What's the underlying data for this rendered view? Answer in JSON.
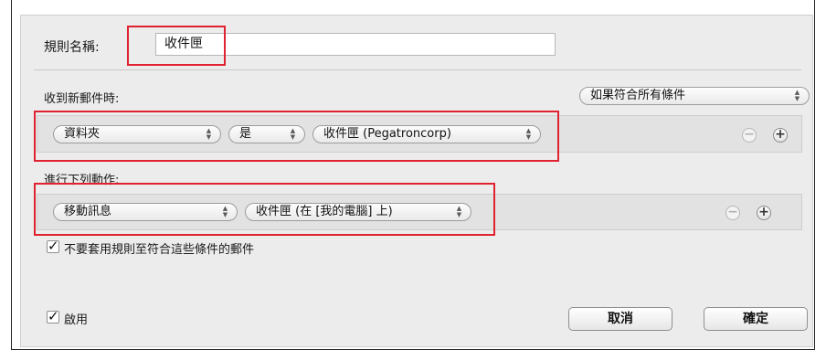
{
  "rule": {
    "name_label": "規則名稱:",
    "name_value": "收件匣"
  },
  "conditions": {
    "heading": "收到新郵件時:",
    "match_mode": "如果符合所有條件",
    "row": {
      "field": "資料夾",
      "operator": "是",
      "value": "收件匣 (Pegatroncorp)"
    }
  },
  "actions": {
    "heading": "進行下列動作:",
    "row": {
      "action": "移動訊息",
      "target": "收件匣 (在 [我的電腦] 上)"
    }
  },
  "options": {
    "dont_apply_label": "不要套用規則至符合這些條件的郵件",
    "enable_label": "啟用"
  },
  "buttons": {
    "cancel": "取消",
    "ok": "確定"
  },
  "icons": {
    "popup_arrows": "up-down-chevron-icon",
    "remove": "minus-circle-icon",
    "add": "plus-circle-icon",
    "checkmark": "checkmark-icon"
  },
  "colors": {
    "highlight": "#e0212f",
    "sheet_background": "#ececec"
  }
}
